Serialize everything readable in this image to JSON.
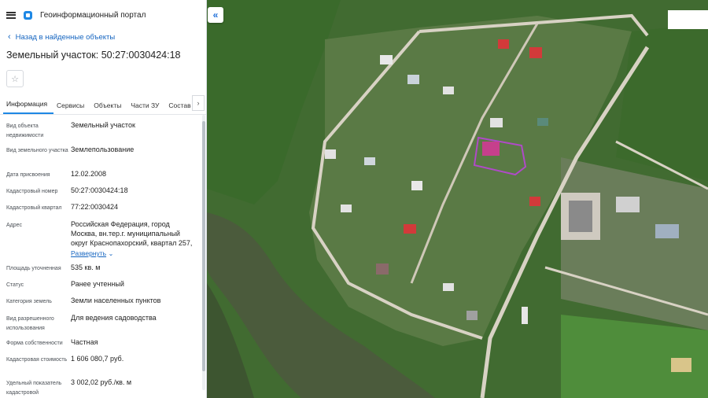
{
  "header": {
    "app_title": "Геоинформационный портал",
    "menu_icon": "menu-icon",
    "logo_icon": "logo-icon"
  },
  "nav": {
    "back_label": "Назад в найденные объекты"
  },
  "object": {
    "title": "Земельный участок: 50:27:0030424:18"
  },
  "tabs": [
    {
      "label": "Информация",
      "active": true
    },
    {
      "label": "Сервисы"
    },
    {
      "label": "Объекты"
    },
    {
      "label": "Части ЗУ"
    },
    {
      "label": "Состав"
    }
  ],
  "properties": [
    {
      "label": "Вид объекта недвижимости",
      "value": "Земельный участок"
    },
    {
      "label": "Вид земельного участка",
      "value": "Землепользование"
    },
    {
      "label": "Дата присвоения",
      "value": "12.02.2008"
    },
    {
      "label": "Кадастровый номер",
      "value": "50:27:0030424:18"
    },
    {
      "label": "Кадастровый квартал",
      "value": "77:22:0030424"
    },
    {
      "label": "Адрес",
      "value": "Российская Федерация, город Москва, вн.тер.г. муниципальный округ Краснопахорский, квартал 257,",
      "expand_label": "Развернуть"
    },
    {
      "label": "Площадь уточненная",
      "value": "535 кв. м"
    },
    {
      "label": "Статус",
      "value": "Ранее учтенный"
    },
    {
      "label": "Категория земель",
      "value": "Земли населенных пунктов"
    },
    {
      "label": "Вид разрешенного использования",
      "value": "Для ведения садоводства"
    },
    {
      "label": "Форма собственности",
      "value": "Частная"
    },
    {
      "label": "Кадастровая стоимость",
      "value": "1 606 080,7 руб."
    },
    {
      "label": "Удельный показатель кадастровой",
      "value": "3 002,02 руб./кв. м"
    }
  ],
  "map": {
    "collapse_icon": "double-chevron-left-icon",
    "parcel_color": "#b04ac8",
    "colors": {
      "forest": "#3f6a2e",
      "river": "#4a5a3a",
      "field": "#4f8a3a",
      "road": "#d8d2c4"
    }
  }
}
